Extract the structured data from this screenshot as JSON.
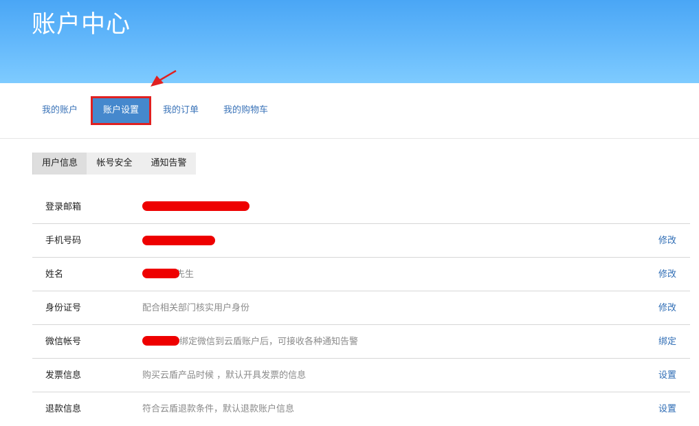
{
  "header": {
    "title": "账户中心"
  },
  "nav": {
    "items": [
      {
        "label": "我的账户"
      },
      {
        "label": "账户设置"
      },
      {
        "label": "我的订单"
      },
      {
        "label": "我的购物车"
      }
    ]
  },
  "subtabs": {
    "items": [
      {
        "label": "用户信息"
      },
      {
        "label": "帐号安全"
      },
      {
        "label": "通知告警"
      }
    ]
  },
  "info": {
    "rows": [
      {
        "label": "登录邮箱",
        "value": "",
        "action": ""
      },
      {
        "label": "手机号码",
        "value": "",
        "action": "修改"
      },
      {
        "label": "姓名",
        "value": "先生",
        "action": "修改"
      },
      {
        "label": "身份证号",
        "value": "配合相关部门核实用户身份",
        "action": "修改"
      },
      {
        "label": "微信帐号",
        "value": "绑定微信到云盾账户后，可接收各种通知告警",
        "action": "绑定"
      },
      {
        "label": "发票信息",
        "value": "购买云盾产品时候 ，默认开具发票的信息",
        "action": "设置"
      },
      {
        "label": "退款信息",
        "value": "符合云盾退款条件，默认退款账户信息",
        "action": "设置"
      }
    ]
  },
  "colors": {
    "banner_top": "#4aa6f5",
    "banner_bottom": "#7ecbff",
    "nav_active_bg": "#4588cd",
    "highlight_red": "#e02020",
    "link_blue": "#2f6db5"
  }
}
